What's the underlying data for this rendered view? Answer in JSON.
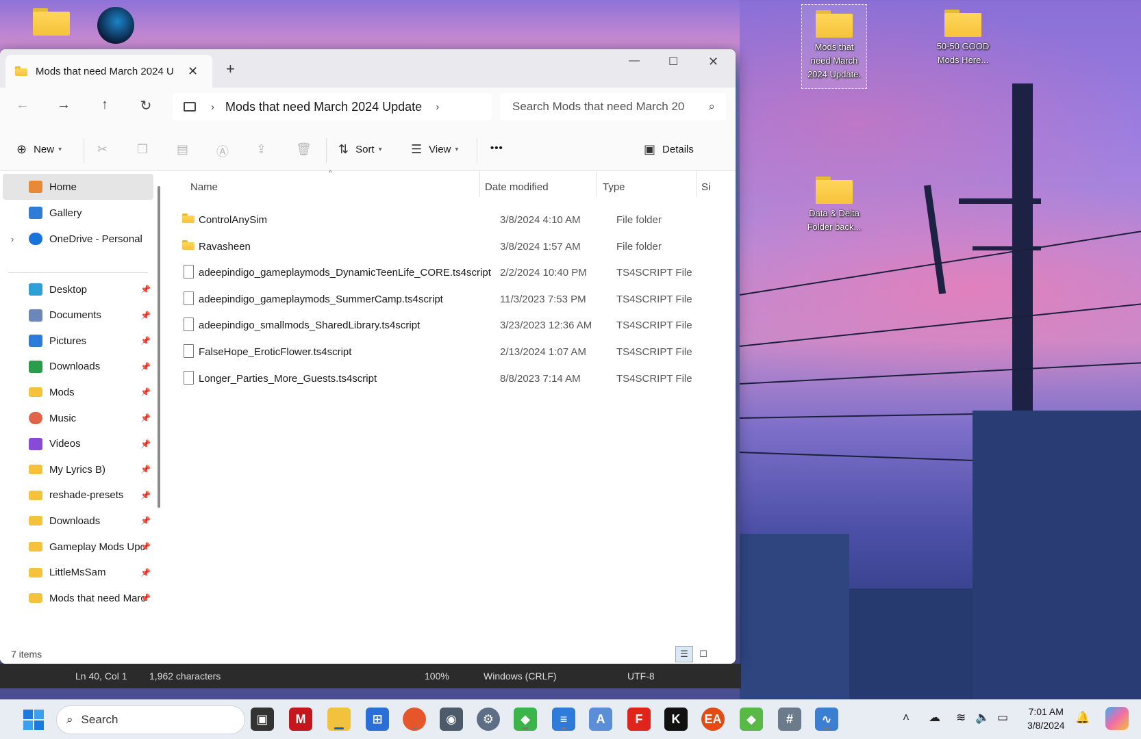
{
  "desktop": {
    "icons": [
      {
        "label": "Mods that need March 2024 Update",
        "display": "Mods that\nneed March\n2024 Update."
      },
      {
        "label": "50-50 GOOD Mods Here...",
        "display": "50-50 GOOD\nMods Here..."
      },
      {
        "label": "Data & Delta Folder back...",
        "display": "Data & Delta\nFolder back..."
      }
    ]
  },
  "explorer": {
    "tab_title": "Mods that need March 2024 U",
    "breadcrumb": "Mods that need March 2024 Update",
    "search_placeholder": "Search Mods that need March 20",
    "toolbar": {
      "new_label": "New",
      "sort_label": "Sort",
      "view_label": "View",
      "more_label": "•••",
      "details_label": "Details"
    },
    "sidebar": {
      "top_items": [
        {
          "label": "Home",
          "icon": "home-icon"
        },
        {
          "label": "Gallery",
          "icon": "gallery-icon"
        },
        {
          "label": "OneDrive - Personal",
          "icon": "cloud-icon"
        }
      ],
      "quick_access": [
        {
          "label": "Desktop",
          "icon": "desktop-icon"
        },
        {
          "label": "Documents",
          "icon": "documents-icon"
        },
        {
          "label": "Pictures",
          "icon": "pictures-icon"
        },
        {
          "label": "Downloads",
          "icon": "download-icon"
        },
        {
          "label": "Mods",
          "icon": "folder-icon"
        },
        {
          "label": "Music",
          "icon": "music-icon"
        },
        {
          "label": "Videos",
          "icon": "videos-icon"
        },
        {
          "label": "My Lyrics B)",
          "icon": "folder-icon"
        },
        {
          "label": "reshade-presets",
          "icon": "folder-icon"
        },
        {
          "label": "Downloads",
          "icon": "folder-icon"
        },
        {
          "label": "Gameplay Mods Upc",
          "icon": "folder-icon"
        },
        {
          "label": "LittleMsSam",
          "icon": "folder-icon"
        },
        {
          "label": "Mods that need Marc",
          "icon": "folder-icon"
        }
      ]
    },
    "columns": {
      "name": "Name",
      "date": "Date modified",
      "type": "Type",
      "size": "Si"
    },
    "files": [
      {
        "name": "ControlAnySim",
        "date": "3/8/2024 4:10 AM",
        "type": "File folder",
        "kind": "folder"
      },
      {
        "name": "Ravasheen",
        "date": "3/8/2024 1:57 AM",
        "type": "File folder",
        "kind": "folder"
      },
      {
        "name": "adeepindigo_gameplaymods_DynamicTeenLife_CORE.ts4script",
        "date": "2/2/2024 10:40 PM",
        "type": "TS4SCRIPT File",
        "kind": "file"
      },
      {
        "name": "adeepindigo_gameplaymods_SummerCamp.ts4script",
        "date": "11/3/2023 7:53 PM",
        "type": "TS4SCRIPT File",
        "kind": "file"
      },
      {
        "name": "adeepindigo_smallmods_SharedLibrary.ts4script",
        "date": "3/23/2023 12:36 AM",
        "type": "TS4SCRIPT File",
        "kind": "file"
      },
      {
        "name": "FalseHope_EroticFlower.ts4script",
        "date": "2/13/2024 1:07 AM",
        "type": "TS4SCRIPT File",
        "kind": "file"
      },
      {
        "name": "Longer_Parties_More_Guests.ts4script",
        "date": "8/8/2023 7:14 AM",
        "type": "TS4SCRIPT File",
        "kind": "file"
      }
    ],
    "status": {
      "count": "7 items"
    }
  },
  "notepad_status": {
    "position": "Ln 40, Col 1",
    "chars": "1,962 characters",
    "zoom": "100%",
    "eol": "Windows (CRLF)",
    "encoding": "UTF-8"
  },
  "taskbar": {
    "search_label": "Search",
    "time": "7:01 AM",
    "date": "3/8/2024",
    "apps": [
      "task-view",
      "mcafee",
      "file-explorer",
      "store",
      "firefox",
      "camera",
      "settings",
      "sims",
      "notepad",
      "wordpad",
      "foxit",
      "inkscape",
      "ea",
      "sims-alt",
      "calculator",
      "resource-monitor"
    ],
    "accent": "#0067c0"
  }
}
